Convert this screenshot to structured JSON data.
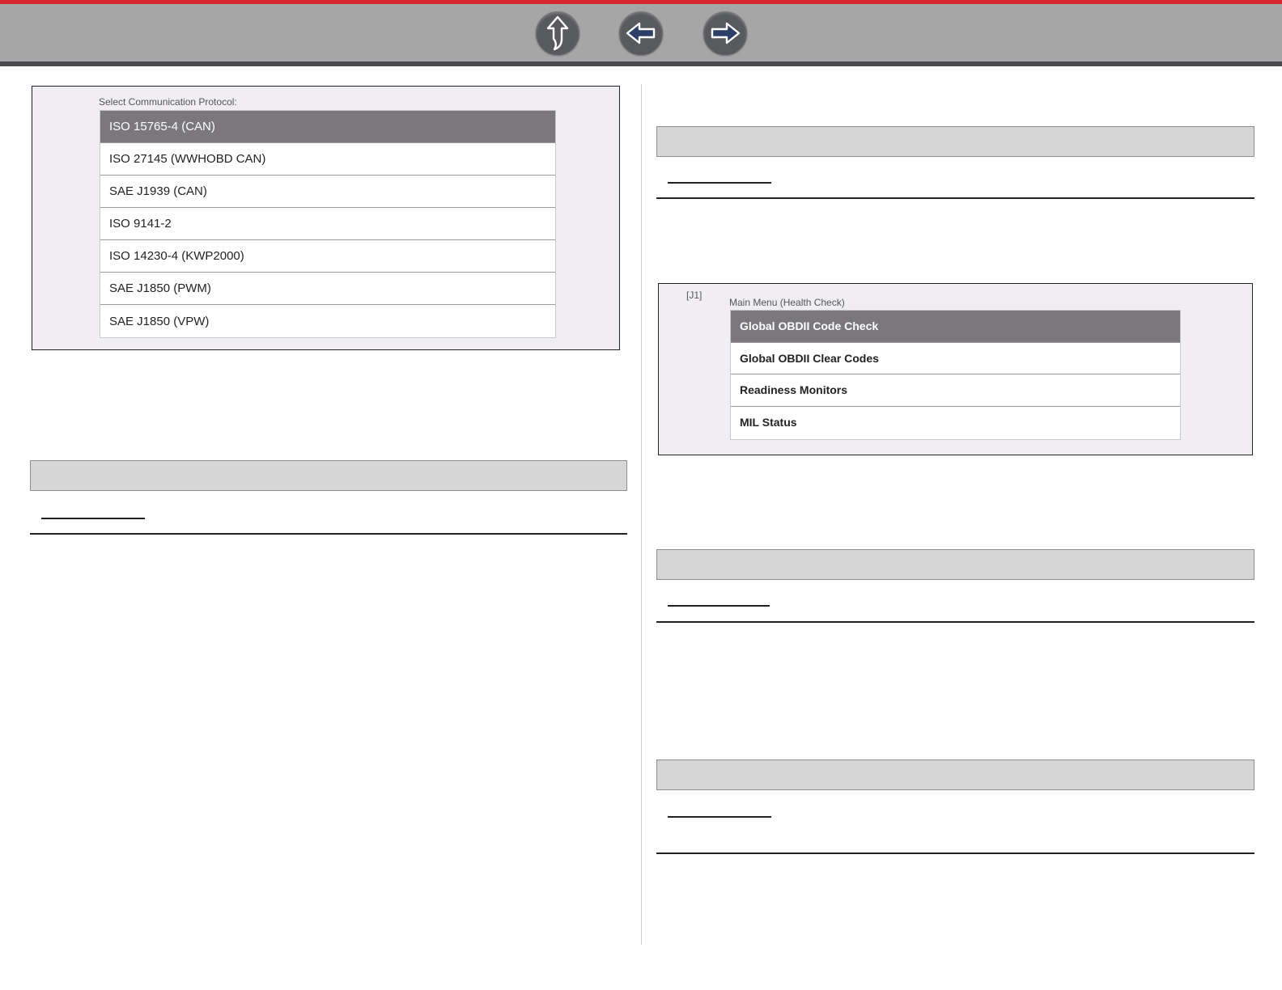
{
  "toolbar": {
    "up_icon": "up-arrow-icon",
    "back_icon": "left-arrow-icon",
    "forward_icon": "right-arrow-icon",
    "accent_color": "#d7262f"
  },
  "protocol_screen": {
    "title": "Select Communication Protocol:",
    "items": [
      {
        "label": "ISO 15765-4 (CAN)",
        "selected": true
      },
      {
        "label": "ISO 27145 (WWHOBD CAN)",
        "selected": false
      },
      {
        "label": "SAE J1939 (CAN)",
        "selected": false
      },
      {
        "label": "ISO 9141-2",
        "selected": false
      },
      {
        "label": "ISO 14230-4 (KWP2000)",
        "selected": false
      },
      {
        "label": "SAE J1850 (PWM)",
        "selected": false
      },
      {
        "label": "SAE J1850 (VPW)",
        "selected": false
      }
    ]
  },
  "health_check_screen": {
    "tag": "[J1]",
    "title": "Main Menu (Health Check)",
    "items": [
      {
        "label": "Global OBDII Code Check",
        "selected": true
      },
      {
        "label": "Global OBDII Clear Codes",
        "selected": false
      },
      {
        "label": "Readiness Monitors",
        "selected": false
      },
      {
        "label": "MIL Status",
        "selected": false
      }
    ]
  }
}
